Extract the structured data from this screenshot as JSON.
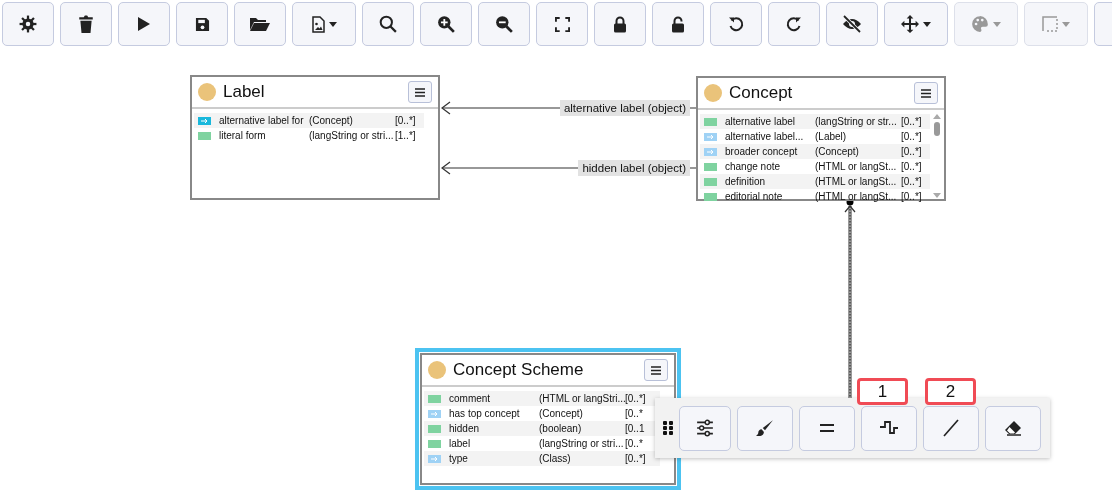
{
  "toolbar": [
    {
      "kind": "button",
      "disabled": false
    },
    {
      "kind": "button",
      "disabled": false
    },
    {
      "kind": "button",
      "disabled": false
    },
    {
      "kind": "button",
      "disabled": false
    },
    {
      "kind": "button",
      "disabled": false
    },
    {
      "kind": "dropdown",
      "disabled": false
    },
    {
      "kind": "button",
      "disabled": false
    },
    {
      "kind": "button",
      "disabled": false
    },
    {
      "kind": "button",
      "disabled": false
    },
    {
      "kind": "button",
      "disabled": false
    },
    {
      "kind": "button",
      "disabled": false
    },
    {
      "kind": "button",
      "disabled": false
    },
    {
      "kind": "button",
      "disabled": false
    },
    {
      "kind": "button",
      "disabled": false
    },
    {
      "kind": "button",
      "disabled": false
    },
    {
      "kind": "dropdown",
      "disabled": false
    },
    {
      "kind": "dropdown",
      "disabled": true
    },
    {
      "kind": "dropdown",
      "disabled": true
    },
    {
      "kind": "button",
      "disabled": false
    }
  ],
  "nodes": [
    {
      "title": "Label",
      "selected": false,
      "scrollable": false,
      "rows": [
        {
          "kind": "object-active",
          "name": "alternative label for",
          "type": "(Concept)",
          "cardinality": "[0..*]"
        },
        {
          "kind": "literal",
          "name": "literal form",
          "type": "(langString or stri...",
          "cardinality": "[1..*]"
        }
      ]
    },
    {
      "title": "Concept",
      "selected": false,
      "scrollable": true,
      "rows": [
        {
          "kind": "literal",
          "name": "alternative label",
          "type": "(langString or str...",
          "cardinality": "[0..*]"
        },
        {
          "kind": "object",
          "name": "alternative label...",
          "type": "(Label)",
          "cardinality": "[0..*]"
        },
        {
          "kind": "object",
          "name": "broader concept",
          "type": "(Concept)",
          "cardinality": "[0..*]"
        },
        {
          "kind": "literal",
          "name": "change note",
          "type": "(HTML or langSt...",
          "cardinality": "[0..*]"
        },
        {
          "kind": "literal",
          "name": "definition",
          "type": "(HTML or langSt...",
          "cardinality": "[0..*]"
        },
        {
          "kind": "literal",
          "name": "editorial note",
          "type": "(HTML or langSt...",
          "cardinality": "[0..*]"
        }
      ]
    },
    {
      "title": "Concept Scheme",
      "selected": true,
      "scrollable": false,
      "rows": [
        {
          "kind": "literal",
          "name": "comment",
          "type": "(HTML or langStri...",
          "cardinality": "[0..*]"
        },
        {
          "kind": "object",
          "name": "has top concept",
          "type": "(Concept)",
          "cardinality": "[0..*"
        },
        {
          "kind": "literal",
          "name": "hidden",
          "type": "(boolean)",
          "cardinality": "[0..1"
        },
        {
          "kind": "literal",
          "name": "label",
          "type": "(langString or stri...",
          "cardinality": "[0..*"
        },
        {
          "kind": "object",
          "name": "type",
          "type": "(Class)",
          "cardinality": "[0..*]"
        }
      ]
    }
  ],
  "links": [
    {
      "label": "alternative label (object)"
    },
    {
      "label": "hidden label (object)"
    }
  ],
  "link_toolbar": {
    "buttons": [
      {
        "kind": "button"
      },
      {
        "kind": "button"
      },
      {
        "kind": "button"
      },
      {
        "kind": "button"
      },
      {
        "kind": "button"
      },
      {
        "kind": "button"
      }
    ],
    "callouts": [
      "1",
      "2"
    ]
  }
}
